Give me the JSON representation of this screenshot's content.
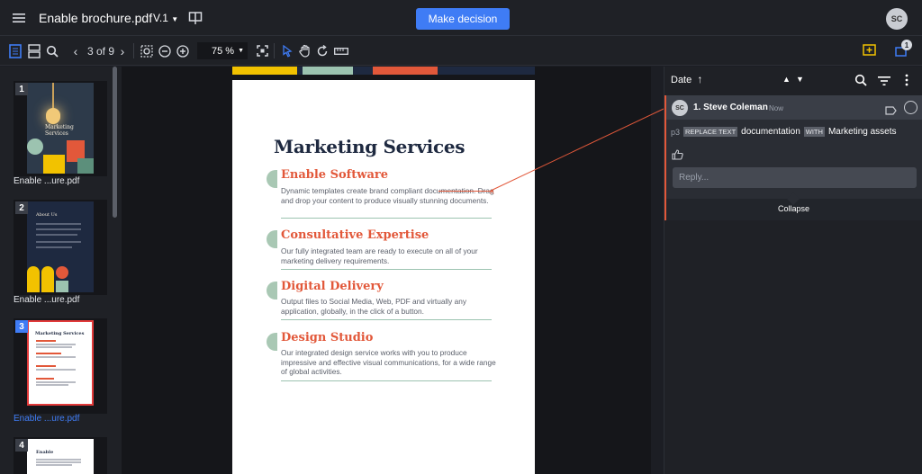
{
  "app": {
    "file_name": "Enable brochure.pdf",
    "version": "V.1",
    "decision_button": "Make decision",
    "user_initials": "SC"
  },
  "toolbar": {
    "page_indicator": "3 of 9",
    "zoom": "75 %",
    "notification_count": "1"
  },
  "thumbnails": [
    {
      "number": "1",
      "label": "Enable ...ure.pdf",
      "selected": false
    },
    {
      "number": "2",
      "label": "Enable ...ure.pdf",
      "selected": false
    },
    {
      "number": "3",
      "label": "Enable ...ure.pdf",
      "selected": true
    },
    {
      "number": "4",
      "label": "",
      "selected": false
    }
  ],
  "thumb_content": {
    "t1_title": "Marketing Services",
    "t2_title": "About Us",
    "t3_title": "Marketing Services",
    "t4_title": "Enable"
  },
  "document": {
    "heading": "Marketing Services",
    "services": [
      {
        "title": "Enable Software",
        "description": "Dynamic templates create brand compliant documentation. Drag and drop your content to produce visually stunning documents."
      },
      {
        "title": "Consultative Expertise",
        "description": "Our fully integrated team are ready to execute on all of your marketing delivery requirements."
      },
      {
        "title": "Digital Delivery",
        "description": "Output files to Social Media, Web, PDF and virtually any application, globally, in the click of a button."
      },
      {
        "title": "Design Studio",
        "description": "Our integrated design service works with you to produce impressive and effective visual communications, for a wide range of global activities."
      }
    ]
  },
  "comments_panel": {
    "sort_label": "Date",
    "comment": {
      "avatar": "SC",
      "author": "1. Steve Coleman",
      "time": "Now",
      "page": "p3",
      "replace_tag": "REPLACE TEXT",
      "old_text": "documentation",
      "with_tag": "WITH",
      "new_text": "Marketing assets"
    },
    "reply_placeholder": "Reply...",
    "collapse_label": "Collapse"
  },
  "colors": {
    "accent_blue": "#3f7cf5",
    "annotation_red": "#e2583a",
    "highlight_yellow": "#f2c200",
    "sage": "#a9c8b4"
  }
}
